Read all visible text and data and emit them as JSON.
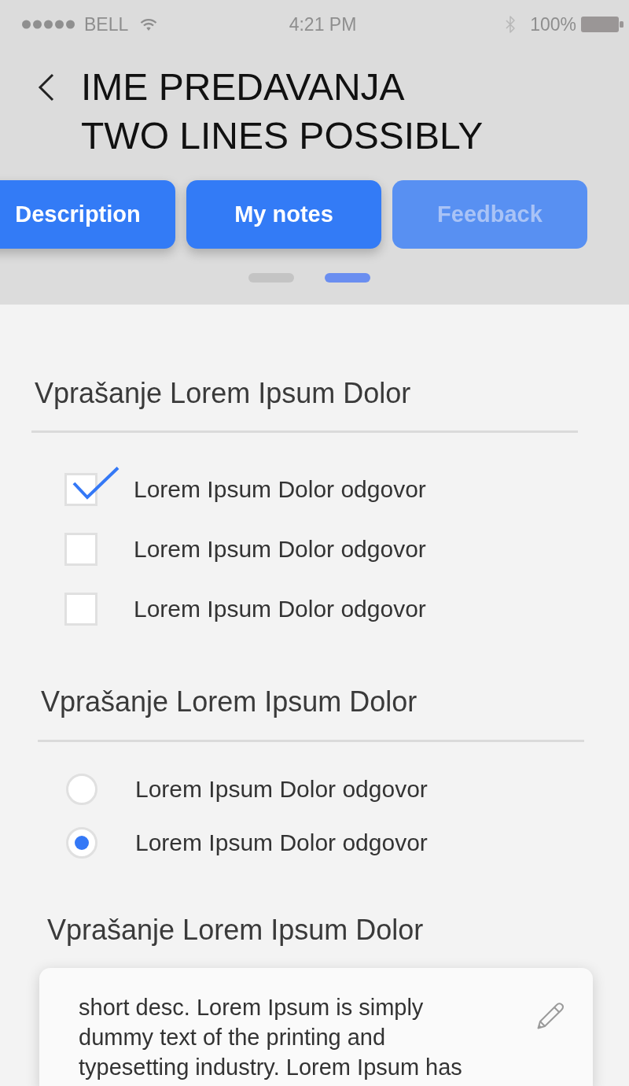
{
  "status_bar": {
    "carrier": "BELL",
    "time": "4:21 PM",
    "battery": "100%"
  },
  "header": {
    "title": "IME PREDAVANJA TWO LINES POSSIBLY"
  },
  "tabs": [
    {
      "label": "Description",
      "disabled": false
    },
    {
      "label": "My notes",
      "disabled": false
    },
    {
      "label": "Feedback",
      "disabled": true
    }
  ],
  "pager": [
    {
      "selected": false
    },
    {
      "selected": true
    }
  ],
  "questions": [
    {
      "kind": "checkbox",
      "title": "Vprašanje Lorem Ipsum Dolor",
      "options": [
        {
          "label": "Lorem Ipsum Dolor odgovor",
          "checked": true
        },
        {
          "label": "Lorem Ipsum Dolor odgovor",
          "checked": false
        },
        {
          "label": "Lorem Ipsum Dolor odgovor",
          "checked": false
        }
      ]
    },
    {
      "kind": "radio",
      "title": "Vprašanje Lorem Ipsum Dolor",
      "options": [
        {
          "label": "Lorem Ipsum Dolor odgovor",
          "selected": false
        },
        {
          "label": "Lorem Ipsum Dolor odgovor",
          "selected": true
        }
      ]
    },
    {
      "kind": "text",
      "title": "Vprašanje Lorem Ipsum Dolor",
      "answer": "short desc. Lorem Ipsum is simply dummy text of the printing and typesetting industry. Lorem Ipsum has"
    }
  ]
}
